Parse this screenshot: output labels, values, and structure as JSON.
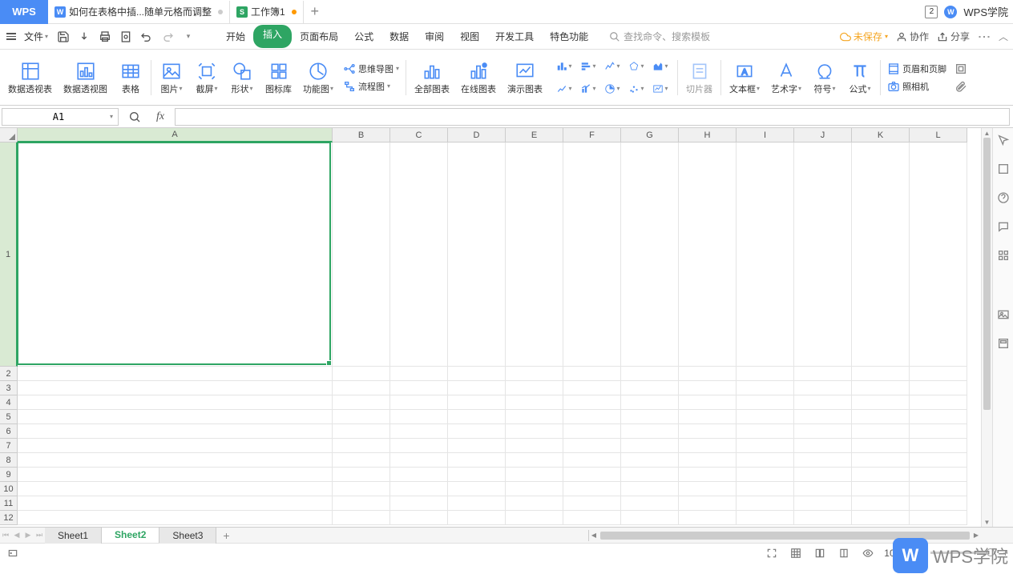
{
  "app_logo": "WPS",
  "tabs": [
    {
      "icon": "W",
      "title": "如何在表格中插...随单元格而调整",
      "dot": "grey"
    },
    {
      "icon": "S",
      "title": "工作簿1",
      "dot": "orange"
    }
  ],
  "titlebar_badge": "2",
  "titlebar_brand": "WPS学院",
  "file_menu_label": "文件",
  "menu_tabs": [
    "开始",
    "插入",
    "页面布局",
    "公式",
    "数据",
    "审阅",
    "视图",
    "开发工具",
    "特色功能"
  ],
  "active_menu_tab": "插入",
  "search_placeholder": "查找命令、搜索模板",
  "menubar_right": {
    "unsaved": "未保存",
    "collab": "协作",
    "share": "分享"
  },
  "ribbon": {
    "pivot_table": "数据透视表",
    "pivot_chart": "数据透视图",
    "table": "表格",
    "picture": "图片",
    "screenshot": "截屏",
    "shapes": "形状",
    "icon_lib": "图标库",
    "func_chart": "功能图",
    "mindmap": "思维导图",
    "flowchart": "流程图",
    "all_charts": "全部图表",
    "online_chart": "在线图表",
    "demo_chart": "演示图表",
    "slicer": "切片器",
    "textbox": "文本框",
    "wordart": "艺术字",
    "symbol": "符号",
    "formula": "公式",
    "header_footer": "页眉和页脚",
    "camera": "照相机"
  },
  "cell_ref": "A1",
  "columns": [
    "A",
    "B",
    "C",
    "D",
    "E",
    "F",
    "G",
    "H",
    "I",
    "J",
    "K",
    "L"
  ],
  "col_widths": {
    "A": 393,
    "default": 72
  },
  "rows": [
    1,
    2,
    3,
    4,
    5,
    6,
    7,
    8,
    9,
    10,
    11,
    12
  ],
  "row_heights": {
    "1": 280,
    "default": 18
  },
  "selected_cell": "A1",
  "sheets": [
    "Sheet1",
    "Sheet2",
    "Sheet3"
  ],
  "active_sheet": "Sheet2",
  "zoom": "100%",
  "watermark": {
    "badge": "W",
    "text": "WPS学院"
  }
}
